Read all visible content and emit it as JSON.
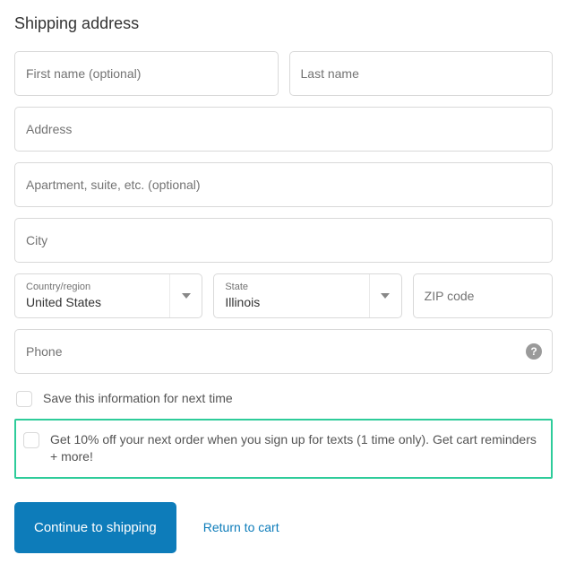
{
  "title": "Shipping address",
  "fields": {
    "first_name_placeholder": "First name (optional)",
    "last_name_placeholder": "Last name",
    "address_placeholder": "Address",
    "apartment_placeholder": "Apartment, suite, etc. (optional)",
    "city_placeholder": "City",
    "zip_placeholder": "ZIP code",
    "phone_placeholder": "Phone"
  },
  "country": {
    "label": "Country/region",
    "value": "United States"
  },
  "state": {
    "label": "State",
    "value": "Illinois"
  },
  "checkboxes": {
    "save_info": "Save this information for next time",
    "sms_offer": "Get 10% off your next order when you sign up for texts (1 time only). Get cart reminders + more!"
  },
  "actions": {
    "continue": "Continue to shipping",
    "return": "Return to cart"
  },
  "help_icon_char": "?"
}
